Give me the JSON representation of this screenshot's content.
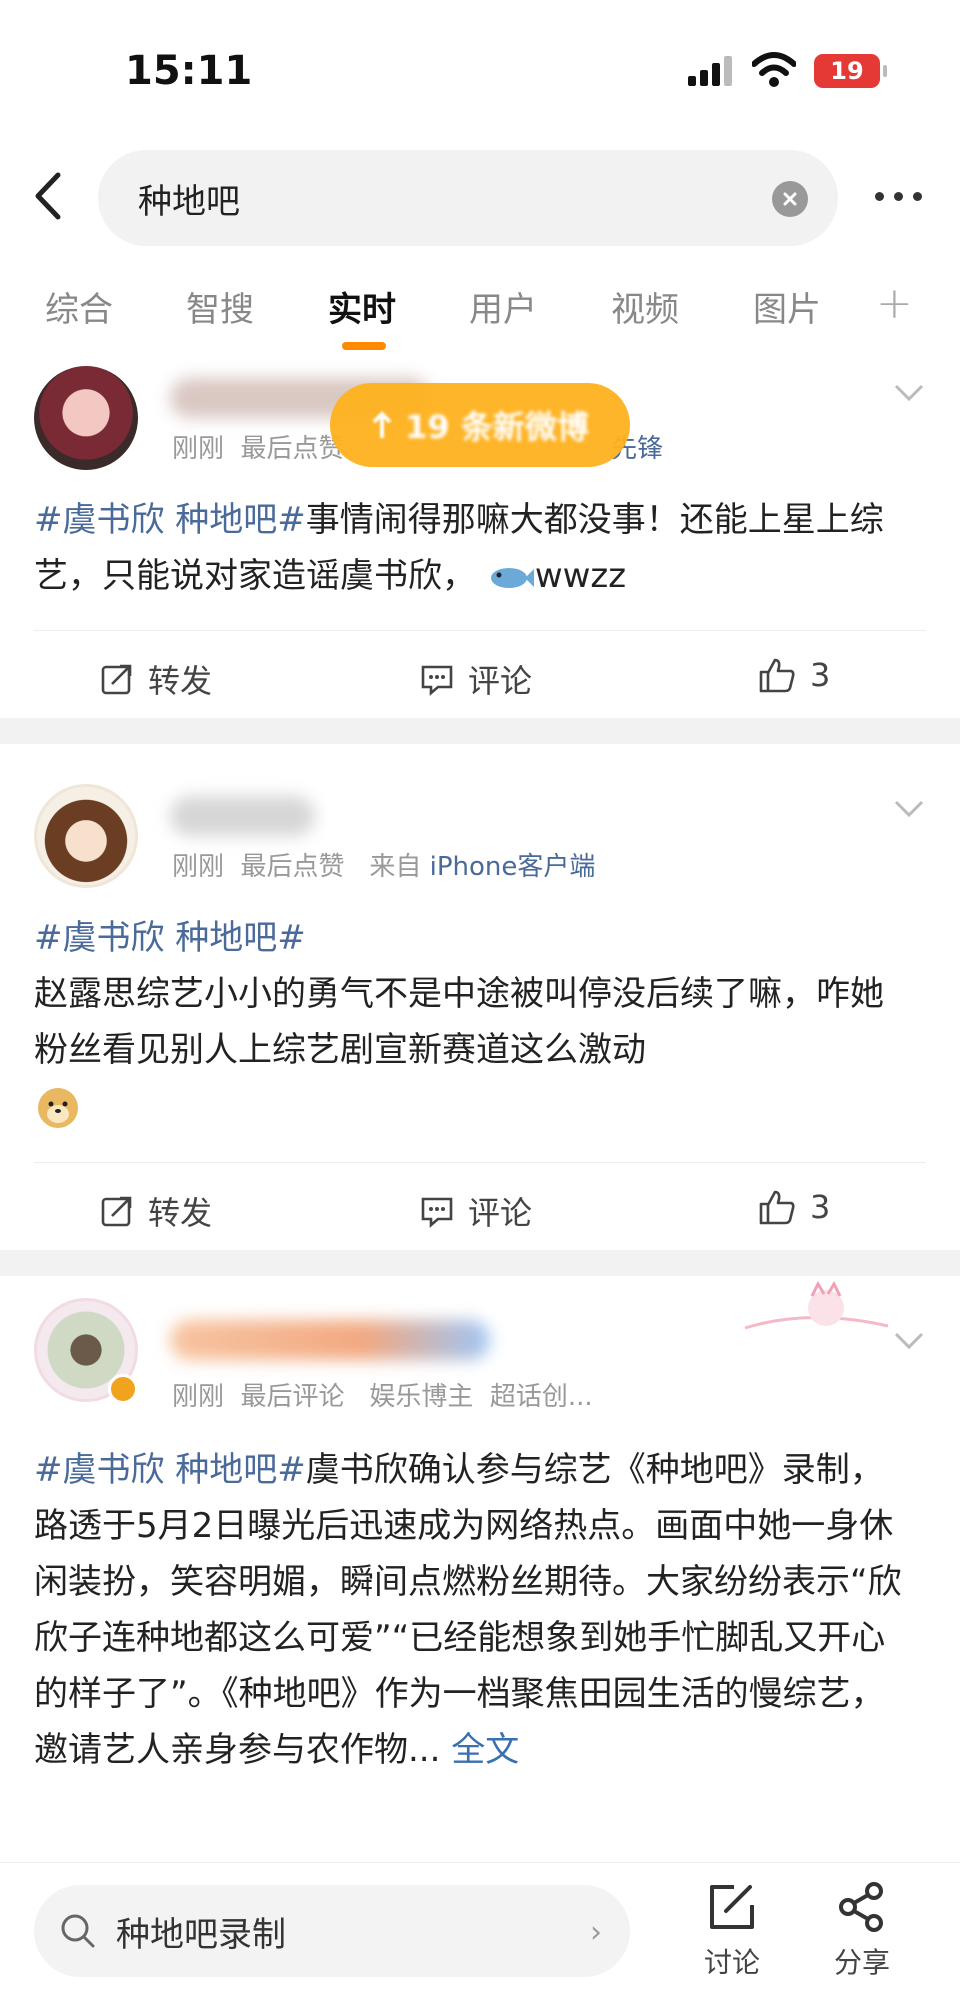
{
  "status": {
    "time": "15:11",
    "battery": "19"
  },
  "search": {
    "query": "种地吧"
  },
  "tabs": [
    {
      "label": "综合"
    },
    {
      "label": "智搜"
    },
    {
      "label": "实时"
    },
    {
      "label": "用户"
    },
    {
      "label": "视频"
    },
    {
      "label": "图片"
    }
  ],
  "new_posts": {
    "label": "19 条新微博"
  },
  "posts": [
    {
      "meta_time": "刚刚",
      "meta_action": "最后点赞",
      "meta_extra": "先锋",
      "tag": "#虞书欣 种地吧#",
      "text": "事情闹得那嘛大都没事！还能上星上综艺，只能说对家造谣虞书欣，",
      "trail": "wwzz",
      "repost": "转发",
      "comment": "评论",
      "likes": "3"
    },
    {
      "meta_time": "刚刚",
      "meta_action": "最后点赞",
      "meta_from": "来自",
      "meta_source": "iPhone客户端",
      "tag": "#虞书欣 种地吧#",
      "text": "赵露思综艺小小的勇气不是中途被叫停没后续了嘛，咋她粉丝看见别人上综艺剧宣新赛道这么激动",
      "repost": "转发",
      "comment": "评论",
      "likes": "3"
    },
    {
      "meta_time": "刚刚",
      "meta_action": "最后评论",
      "meta_role": "娱乐博主",
      "meta_extra": "超话创...",
      "tag": "#虞书欣 种地吧#",
      "text": "虞书欣确认参与综艺《种地吧》录制，路透于5月2日曝光后迅速成为网络热点。画面中她一身休闲装扮，笑容明媚，瞬间点燃粉丝期待。大家纷纷表示“欣欣子连种地都这么可爱”“已经能想象到她手忙脚乱又开心的样子了”。《种地吧》作为一档聚焦田园生活的慢综艺，邀请艺人亲身参与农作物...",
      "fulltext": "全文"
    }
  ],
  "bottom": {
    "search_text": "种地吧录制",
    "discuss_label": "讨论",
    "share_label": "分享"
  },
  "colors": {
    "accent": "#ff8a00",
    "tag": "#4a6a9a",
    "pill": "#ffb21e",
    "battery": "#e53935"
  }
}
